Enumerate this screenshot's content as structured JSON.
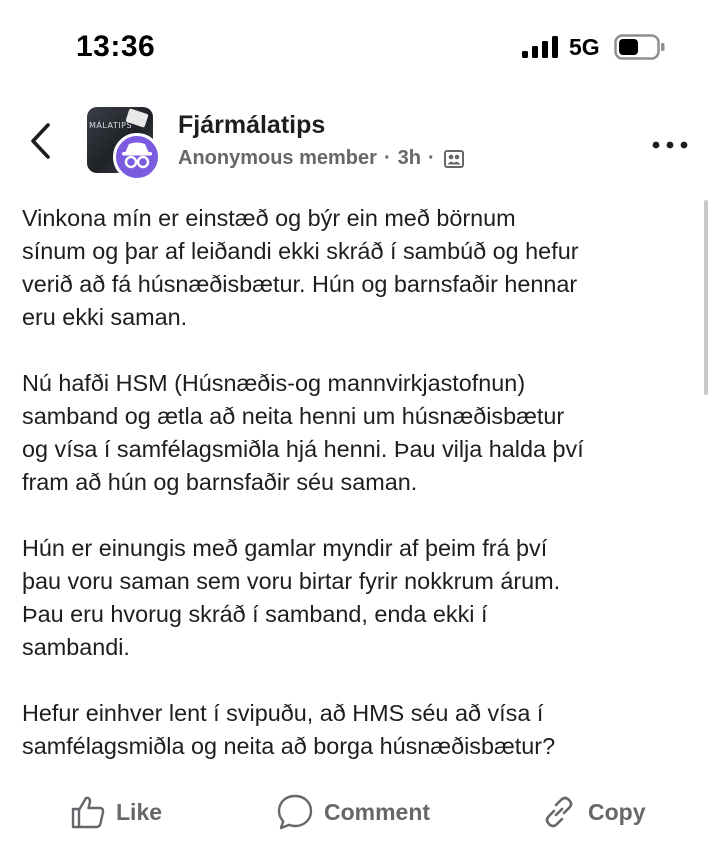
{
  "status_bar": {
    "time": "13:36",
    "network": "5G"
  },
  "header": {
    "group_name": "Fjármálatips",
    "thumb_text": "MÁLATIPS",
    "author": "Anonymous member",
    "separator": "·",
    "time_ago": "3h",
    "privacy_icon": "members-icon",
    "back_icon": "chevron-left-icon",
    "more_icon": "more-dots-icon"
  },
  "post": {
    "paragraphs": [
      "Vinkona mín er einstæð og býr ein með börnum\nsínum og þar af leiðandi ekki skráð í sambúð og hefur\nverið að fá húsnæðisbætur. Hún og barnsfaðir hennar\neru ekki saman.",
      "Nú hafði HSM (Húsnæðis-og mannvirkjastofnun)\nsamband og ætla að neita henni um húsnæðisbætur\nog vísa í samfélagsmiðla hjá henni. Þau vilja halda því\nfram að hún og barnsfaðir séu saman.",
      "Hún er einungis með gamlar myndir af þeim frá því\nþau voru saman sem voru birtar fyrir nokkrum árum.\nÞau eru hvorug skráð í samband, enda ekki í\nsambandi.",
      "Hefur einhver lent í svipuðu, að HMS séu að vísa í\nsamfélagsmiðla og neita að borga húsnæðisbætur?"
    ]
  },
  "actions": {
    "like": "Like",
    "comment": "Comment",
    "copy": "Copy"
  },
  "colors": {
    "text": "#1c1e21",
    "secondary": "#65676b",
    "anon_badge": "#7b5ce0"
  }
}
